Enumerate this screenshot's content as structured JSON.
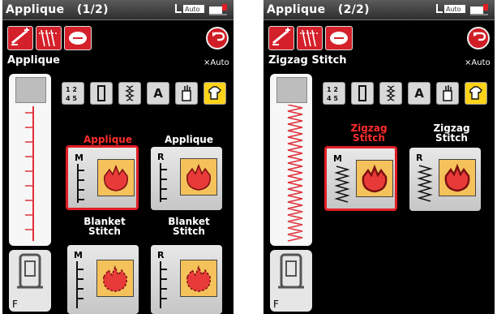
{
  "screens": [
    {
      "title": "Applique",
      "page": "(1/2)",
      "auto_badge": "Auto",
      "pattern_name": "Applique",
      "presser_foot": "F",
      "stitches": [
        {
          "name": "Applique",
          "mark": "M",
          "selected": true
        },
        {
          "name": "Applique",
          "mark": "R",
          "selected": false
        },
        {
          "name": "Blanket Stitch",
          "mark": "M",
          "selected": false
        },
        {
          "name": "Blanket Stitch",
          "mark": "R",
          "selected": false
        }
      ]
    },
    {
      "title": "Applique",
      "page": "(2/2)",
      "auto_badge": "Auto",
      "pattern_name": "Zigzag Stitch",
      "presser_foot": "F",
      "stitches": [
        {
          "name": "Zigzag Stitch",
          "mark": "M",
          "selected": true
        },
        {
          "name": "Zigzag Stitch",
          "mark": "R",
          "selected": false
        }
      ]
    }
  ],
  "categories": [
    "utility",
    "buttonhole",
    "decorative",
    "letters",
    "quilt",
    "applique"
  ],
  "category_glyph": {
    "letters": "A"
  },
  "active_category": "applique",
  "colors": {
    "accent_red": "#d4202a",
    "active_yellow": "#ffd319",
    "panel_gray": "#d6d6d6",
    "background": "#000000"
  }
}
